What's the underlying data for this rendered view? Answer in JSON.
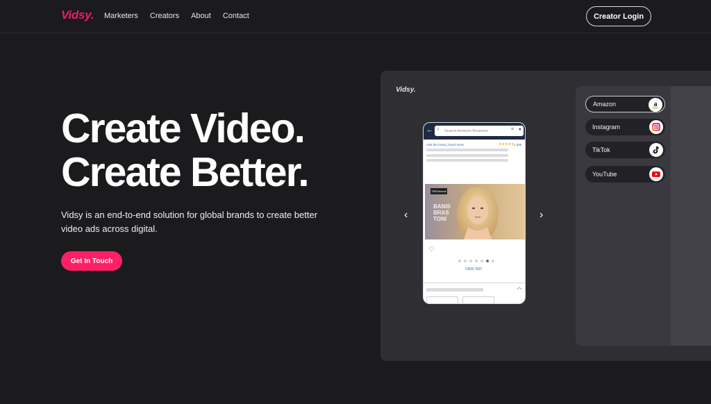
{
  "header": {
    "logo": "Vidsy.",
    "nav": [
      "Marketers",
      "Creators",
      "About",
      "Contact"
    ],
    "login_label": "Creator Login"
  },
  "hero": {
    "title_line1": "Create Video.",
    "title_line2": "Create Better.",
    "subtitle": "Vidsy is an end-to-end solution for global brands to create better video ads across digital.",
    "cta_label": "Get In Touch"
  },
  "showcase": {
    "logo": "Vidsy.",
    "platforms": [
      {
        "label": "Amazon",
        "icon": "amazon-icon",
        "active": true
      },
      {
        "label": "Instagram",
        "icon": "instagram-icon",
        "active": false
      },
      {
        "label": "TikTok",
        "icon": "tiktok-icon",
        "active": false
      },
      {
        "label": "YouTube",
        "icon": "youtube-icon",
        "active": false
      }
    ],
    "phone": {
      "search_placeholder": "Search Amazon Business",
      "store_link": "Visit the brand_brand store",
      "stars": "★★★★★",
      "rating_count": "1,366",
      "product_overlay": "BANIS\nBRAS\nTONI",
      "badge": "TRESemmé",
      "view_label": "VIEW 360°",
      "carousel_active_index": 5,
      "carousel_count": 7
    }
  },
  "colors": {
    "brand": "#ee1d67",
    "cta": "#ff1f67",
    "background": "#1b1a1d",
    "panel": "#2f2e33"
  }
}
